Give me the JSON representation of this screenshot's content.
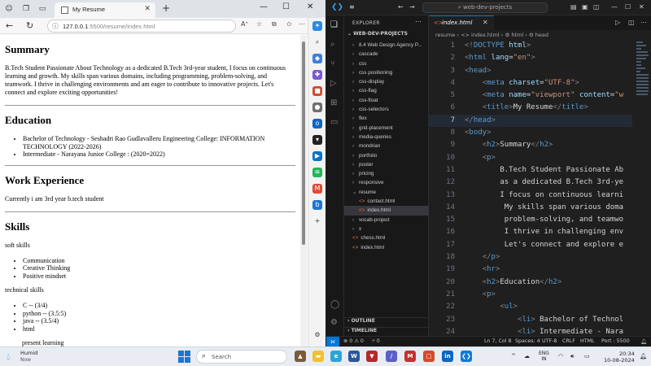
{
  "browser": {
    "tab_title": "My Resume",
    "url_host": "127.0.0.1",
    "url_rest": ":5500/resume/index.html",
    "resume": {
      "summary_heading": "Summary",
      "summary_text": "B.Tech Student Passionate About Technology as a dedicated B.Tech 3rd-year student, I focus on continuous learning and growth. My skills span various domains, including programming, problem-solving, and teamwork. I thrive in challenging environments and am eager to contribute to innovative projects. Let's connect and explore exciting opportunities!",
      "education_heading": "Education",
      "education_items": [
        "Bachelor of Technology - Seshadri Rao Gudlavalleru Engineering College: INFORMATION TECHNOLOGY (2022-2026)",
        "Intermediate - Narayana Junior College : (2020=2022)"
      ],
      "work_heading": "Work Experience",
      "work_text": "Currently i am 3rd year b.tech student",
      "skills_heading": "Skills",
      "soft_label": "soft skills",
      "soft_items": [
        "Communication",
        "Creative Thinking",
        "Positive mindset"
      ],
      "tech_label": "technical skills",
      "tech_items": [
        "C -- (3/4)",
        "python -- (3.5:5)",
        "java -- (3.5/4)",
        "html"
      ],
      "present_label": "present learning"
    }
  },
  "vscode": {
    "search_text": "web-dev-projects",
    "explorer_label": "EXPLORER",
    "project_label": "WEB-DEV-PROJECTS",
    "tree": [
      {
        "label": "8.4 Web Design Agency P...",
        "kind": "folder"
      },
      {
        "label": "cascade",
        "kind": "folder"
      },
      {
        "label": "css",
        "kind": "folder"
      },
      {
        "label": "css positioning",
        "kind": "folder"
      },
      {
        "label": "css-display",
        "kind": "folder"
      },
      {
        "label": "css-flag",
        "kind": "folder"
      },
      {
        "label": "css-float",
        "kind": "folder"
      },
      {
        "label": "css-selectors",
        "kind": "folder"
      },
      {
        "label": "flex",
        "kind": "folder"
      },
      {
        "label": "grid-placement",
        "kind": "folder"
      },
      {
        "label": "media-queries",
        "kind": "folder"
      },
      {
        "label": "mondrian",
        "kind": "folder"
      },
      {
        "label": "portfolio",
        "kind": "folder"
      },
      {
        "label": "poster",
        "kind": "folder"
      },
      {
        "label": "pricing",
        "kind": "folder"
      },
      {
        "label": "responsive",
        "kind": "folder"
      },
      {
        "label": "resume",
        "kind": "open"
      },
      {
        "label": "contact.html",
        "kind": "sub"
      },
      {
        "label": "index.html",
        "kind": "subsel"
      },
      {
        "label": "vocab-project",
        "kind": "folder"
      },
      {
        "label": "x",
        "kind": "folder"
      },
      {
        "label": "chess.html",
        "kind": "file"
      },
      {
        "label": "index.html",
        "kind": "file"
      }
    ],
    "outline_label": "OUTLINE",
    "timeline_label": "TIMELINE",
    "tab_name": "index.html",
    "breadcrumb": "resume  ›  <> index.html  ›  ⚙ html  ›  ⚙ head",
    "status": {
      "errors": "⊗ 0 ⚠ 0",
      "ports": "⑂ 0",
      "position": "Ln 7, Col 8",
      "spaces": "Spaces: 4",
      "encoding": "UTF-8",
      "eol": "CRLF",
      "language": "HTML",
      "port": "Port : 5500"
    }
  },
  "taskbar": {
    "weather_title": "Humid",
    "weather_sub": "Now",
    "search_label": "Search",
    "lang_1": "ENG",
    "lang_2": "IN",
    "time": "20:34",
    "date": "10-08-2024"
  },
  "colors": {
    "vscode_accent": "#0078d4",
    "html_tag": "#569cd6",
    "html_attr": "#9cdcfe",
    "html_string": "#ce9178"
  }
}
